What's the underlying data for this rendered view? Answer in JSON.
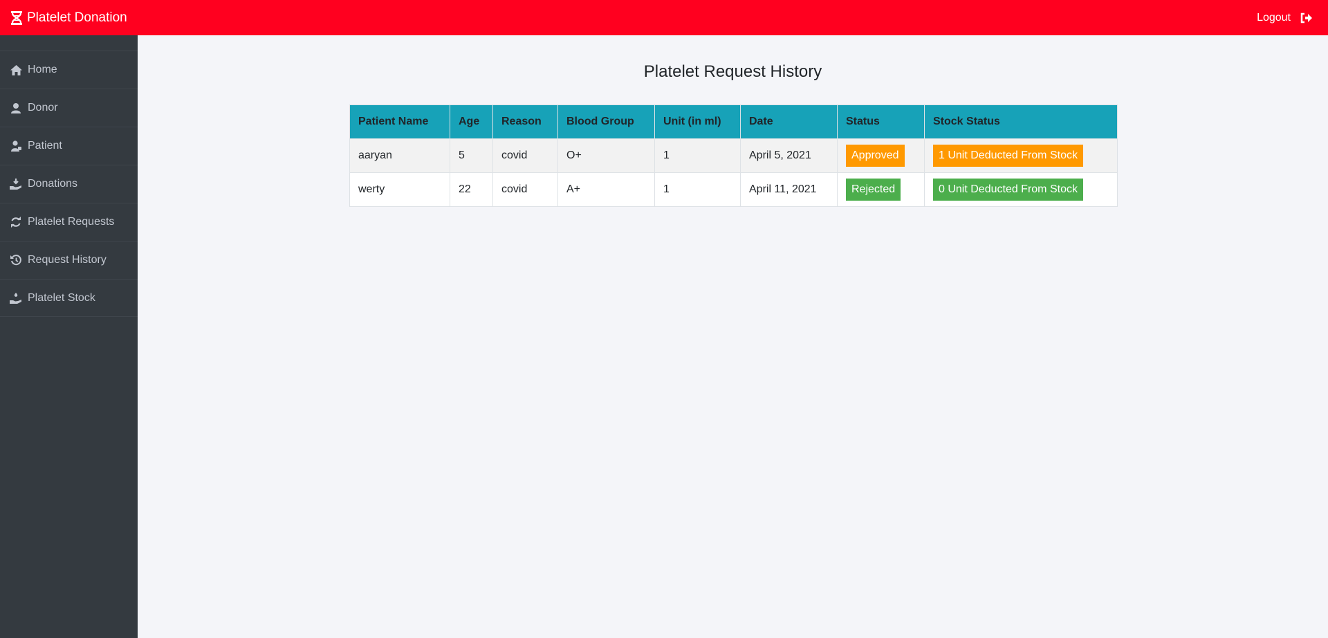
{
  "app": {
    "title": "Platelet Donation",
    "logout_label": "Logout"
  },
  "sidebar": {
    "items": [
      {
        "label": "Home",
        "icon": "home-icon"
      },
      {
        "label": "Donor",
        "icon": "user-icon"
      },
      {
        "label": "Patient",
        "icon": "patient-icon"
      },
      {
        "label": "Donations",
        "icon": "donation-icon"
      },
      {
        "label": "Platelet Requests",
        "icon": "refresh-icon"
      },
      {
        "label": "Request History",
        "icon": "history-icon"
      },
      {
        "label": "Platelet Stock",
        "icon": "hand-holding-icon"
      }
    ]
  },
  "main": {
    "title": "Platelet Request History",
    "columns": [
      "Patient Name",
      "Age",
      "Reason",
      "Blood Group",
      "Unit (in ml)",
      "Date",
      "Status",
      "Stock Status"
    ],
    "rows": [
      {
        "name": "aaryan",
        "age": "5",
        "reason": "covid",
        "blood_group": "O+",
        "unit": "1",
        "date": "April 5, 2021",
        "status": "Approved",
        "stock_status": "1 Unit Deducted From Stock"
      },
      {
        "name": "werty",
        "age": "22",
        "reason": "covid",
        "blood_group": "A+",
        "unit": "1",
        "date": "April 11, 2021",
        "status": "Rejected",
        "stock_status": "0 Unit Deducted From Stock"
      }
    ]
  },
  "colors": {
    "topbar": "#ff001f",
    "sidebar": "#343a40",
    "table_header": "#17a2b8",
    "badge_orange": "#ff9900",
    "badge_green": "#4cae4c"
  }
}
